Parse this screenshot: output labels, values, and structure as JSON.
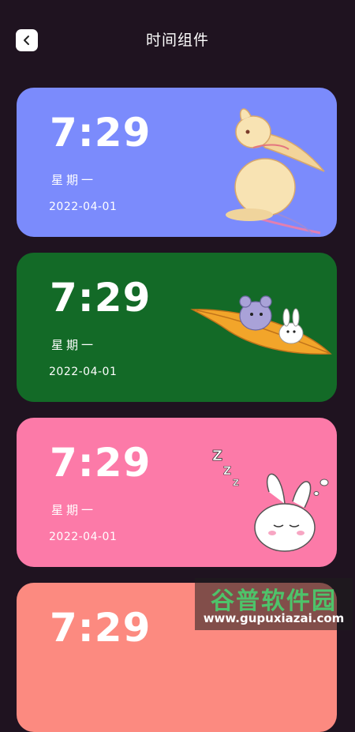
{
  "header": {
    "title": "时间组件",
    "back_icon": "chevron-left-icon"
  },
  "cards": [
    {
      "time": "7:29",
      "weekday": "星期一",
      "date": "2022-04-01",
      "bg": "#7b8bfc",
      "illustration": "rabbit-on-cloud-illustration"
    },
    {
      "time": "7:29",
      "weekday": "星期一",
      "date": "2022-04-01",
      "bg": "#136a27",
      "illustration": "mouse-rabbit-leaf-illustration"
    },
    {
      "time": "7:29",
      "weekday": "星期一",
      "date": "2022-04-01",
      "bg": "#fc7aa8",
      "illustration": "sleeping-rabbit-illustration"
    },
    {
      "time": "7:29",
      "bg": "#fc8a80"
    }
  ],
  "watermark": {
    "text": "谷普软件园",
    "url": "www.gupuxiazai.com"
  }
}
